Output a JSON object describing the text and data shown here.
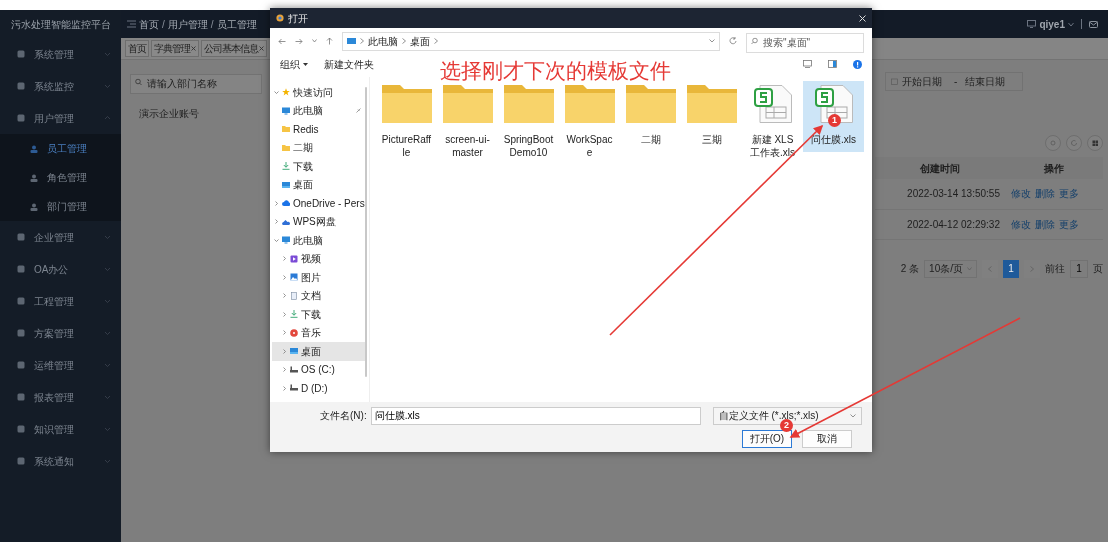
{
  "app": {
    "logo": "污水处理智能监控平台",
    "sidebar": [
      {
        "label": "系统管理",
        "expanded": false,
        "selected": false
      },
      {
        "label": "系统监控",
        "expanded": false,
        "selected": false
      },
      {
        "label": "用户管理",
        "expanded": true,
        "selected": false,
        "children": [
          {
            "label": "员工管理",
            "selected": true
          },
          {
            "label": "角色管理",
            "selected": false
          },
          {
            "label": "部门管理",
            "selected": false
          }
        ]
      },
      {
        "label": "企业管理",
        "expanded": false,
        "selected": false
      },
      {
        "label": "OA办公",
        "expanded": false,
        "selected": false
      },
      {
        "label": "工程管理",
        "expanded": false,
        "selected": false
      },
      {
        "label": "方案管理",
        "expanded": false,
        "selected": false
      },
      {
        "label": "运维管理",
        "expanded": false,
        "selected": false
      },
      {
        "label": "报表管理",
        "expanded": false,
        "selected": false
      },
      {
        "label": "知识管理",
        "expanded": false,
        "selected": false
      },
      {
        "label": "系统通知",
        "expanded": false,
        "selected": false
      }
    ],
    "breadcrumb": [
      "首页",
      "用户管理",
      "员工管理"
    ],
    "breadcrumb_separator": "/",
    "user": "qiye1",
    "tabs": [
      {
        "label": "首页",
        "selected": false,
        "closable": false
      },
      {
        "label": "字典管理",
        "selected": false,
        "closable": true
      },
      {
        "label": "公司基本信息",
        "selected": false,
        "closable": true
      }
    ],
    "search": {
      "placeholder": "请输入部门名称"
    },
    "tree": [
      "演示企业账号"
    ],
    "date_range": {
      "start_placeholder": "开始日期",
      "separator": "-",
      "end_placeholder": "结束日期"
    },
    "table": {
      "columns": [
        "创建时间",
        "操作"
      ],
      "rows": [
        {
          "created": "2022-03-14 13:50:55",
          "actions": [
            "修改",
            "删除",
            "更多"
          ]
        },
        {
          "created": "2022-04-12 02:29:32",
          "actions": [
            "修改",
            "删除",
            "更多"
          ]
        }
      ]
    },
    "pagination": {
      "total": "2 条",
      "page_size": "10条/页",
      "pages": [
        {
          "label": "1",
          "selected": true
        }
      ],
      "goto_label": "前往",
      "goto_value": "1",
      "goto_suffix": "页"
    }
  },
  "dialog": {
    "title": "打开",
    "path": [
      "此电脑",
      "桌面"
    ],
    "search_placeholder": "搜索\"桌面\"",
    "toolbar": [
      {
        "label": "组织",
        "dropdown": true
      },
      {
        "label": "新建文件夹",
        "dropdown": false
      }
    ],
    "nav": [
      {
        "label": "快速访问",
        "kind": "star",
        "expanded": true,
        "selected": false,
        "children": [
          {
            "label": "此电脑",
            "kind": "pc",
            "selected": false,
            "pinned": true
          },
          {
            "label": "Redis",
            "kind": "folder",
            "selected": false,
            "pinned": false
          },
          {
            "label": "二期",
            "kind": "folder",
            "selected": false,
            "pinned": false
          },
          {
            "label": "下载",
            "kind": "download",
            "selected": false,
            "pinned": false
          },
          {
            "label": "桌面",
            "kind": "desktop",
            "selected": false,
            "pinned": false
          }
        ]
      },
      {
        "label": "OneDrive - Pers",
        "kind": "cloud",
        "expanded": false,
        "selected": false
      },
      {
        "label": "WPS网盘",
        "kind": "wps",
        "expanded": false,
        "selected": false
      },
      {
        "label": "此电脑",
        "kind": "pc",
        "expanded": true,
        "selected": false,
        "children": [
          {
            "label": "视频",
            "kind": "video",
            "expanded": false,
            "selected": false
          },
          {
            "label": "图片",
            "kind": "picture",
            "expanded": false,
            "selected": false
          },
          {
            "label": "文档",
            "kind": "document",
            "expanded": false,
            "selected": false
          },
          {
            "label": "下载",
            "kind": "download",
            "expanded": false,
            "selected": false
          },
          {
            "label": "音乐",
            "kind": "music",
            "expanded": false,
            "selected": false
          },
          {
            "label": "桌面",
            "kind": "desktop",
            "expanded": false,
            "selected": true
          },
          {
            "label": "OS (C:)",
            "kind": "drive",
            "expanded": false,
            "selected": false
          },
          {
            "label": "D (D:)",
            "kind": "drive",
            "expanded": false,
            "selected": false
          }
        ]
      }
    ],
    "files": [
      {
        "name": "PictureRaffle",
        "kind": "folder",
        "selected": false
      },
      {
        "name": "screen-ui-master",
        "kind": "folder",
        "selected": false
      },
      {
        "name": "SpringBootDemo10",
        "kind": "folder",
        "selected": false
      },
      {
        "name": "WorkSpace",
        "kind": "folder",
        "selected": false
      },
      {
        "name": "二期",
        "kind": "folder",
        "selected": false
      },
      {
        "name": "三期",
        "kind": "folder",
        "selected": false
      },
      {
        "name": "新建 XLS 工作表.xls",
        "kind": "xls",
        "selected": false
      },
      {
        "name": "问仕膜.xls",
        "kind": "xls",
        "selected": true
      }
    ],
    "filename_label": "文件名(N):",
    "filename": "问仕膜.xls",
    "filter": "自定义文件 (*.xls;*.xls)",
    "buttons": [
      {
        "label": "打开(O)",
        "kind": "primary"
      },
      {
        "label": "取消",
        "kind": "secondary"
      }
    ]
  },
  "annotation": {
    "text": "选择刚才下次的模板文件",
    "markers": [
      "1",
      "2"
    ]
  }
}
